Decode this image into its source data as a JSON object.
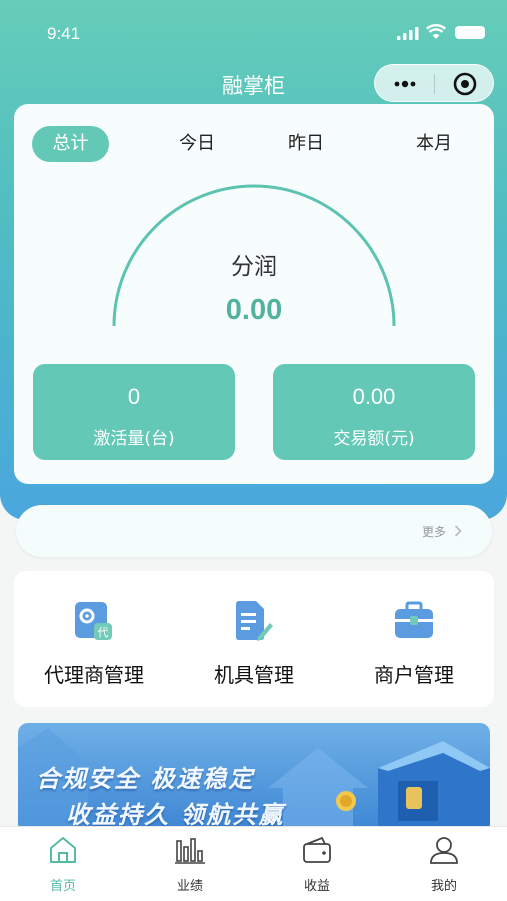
{
  "status_bar": {
    "time": "9:41"
  },
  "nav": {
    "title": "融掌柜"
  },
  "period_tabs": [
    {
      "label": "总计",
      "active": true
    },
    {
      "label": "今日",
      "active": false
    },
    {
      "label": "昨日",
      "active": false
    },
    {
      "label": "本月",
      "active": false
    }
  ],
  "profit": {
    "label": "分润",
    "value": "0.00"
  },
  "stats": [
    {
      "value": "0",
      "label": "激活量(台)"
    },
    {
      "value": "0.00",
      "label": "交易额(元)"
    }
  ],
  "notice": {
    "more_label": "更多",
    "more_icon": "chevron-right-icon"
  },
  "menu": [
    {
      "label": "代理商管理",
      "icon": "agent-settings-icon",
      "icon_badge": "代"
    },
    {
      "label": "机具管理",
      "icon": "document-edit-icon"
    },
    {
      "label": "商户管理",
      "icon": "briefcase-icon"
    }
  ],
  "banner": {
    "line1": "合规安全  极速稳定",
    "line2": "收益持久  领航共赢"
  },
  "tabbar": [
    {
      "label": "首页",
      "icon": "home-icon",
      "active": true
    },
    {
      "label": "业绩",
      "icon": "bar-chart-icon",
      "active": false
    },
    {
      "label": "收益",
      "icon": "wallet-icon",
      "active": false
    },
    {
      "label": "我的",
      "icon": "user-icon",
      "active": false
    }
  ],
  "colors": {
    "accent": "#63c9b6",
    "accent_text": "#52b29e",
    "active_tab": "#55b9a4",
    "gradient_top": "#66cdb8",
    "gradient_bottom": "#4aa7dd"
  }
}
